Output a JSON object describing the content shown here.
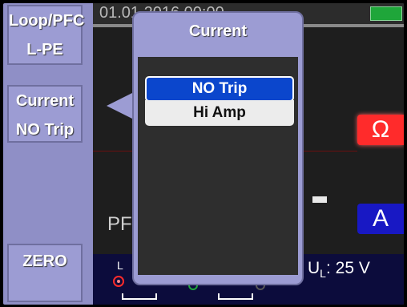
{
  "side_menu": {
    "function_top": "Loop/PFC",
    "function_bottom": "L-PE",
    "mode_top": "Current",
    "mode_bottom": "NO Trip",
    "zero": "ZERO"
  },
  "status_bar": {
    "datetime": "01.01.2016 00:00",
    "battery": "battery-full-icon"
  },
  "measurement": {
    "unit_resistance": "Ω",
    "unit_current": "A",
    "dash": "-",
    "pf_label": "PF"
  },
  "terminals": {
    "l_label": "L",
    "ul_prefix": "U",
    "ul_sub": "L",
    "ul_value": ": 25 V"
  },
  "popup": {
    "title": "Current",
    "options": [
      {
        "label": "NO Trip",
        "selected": true
      },
      {
        "label": "Hi Amp",
        "selected": false
      }
    ]
  },
  "colors": {
    "menu_bg": "#9c9cd3",
    "selected_option": "#0b46cc",
    "ohm_unit": "#ff2b2b",
    "amp_unit": "#1818c4",
    "battery": "#1fa63a"
  }
}
